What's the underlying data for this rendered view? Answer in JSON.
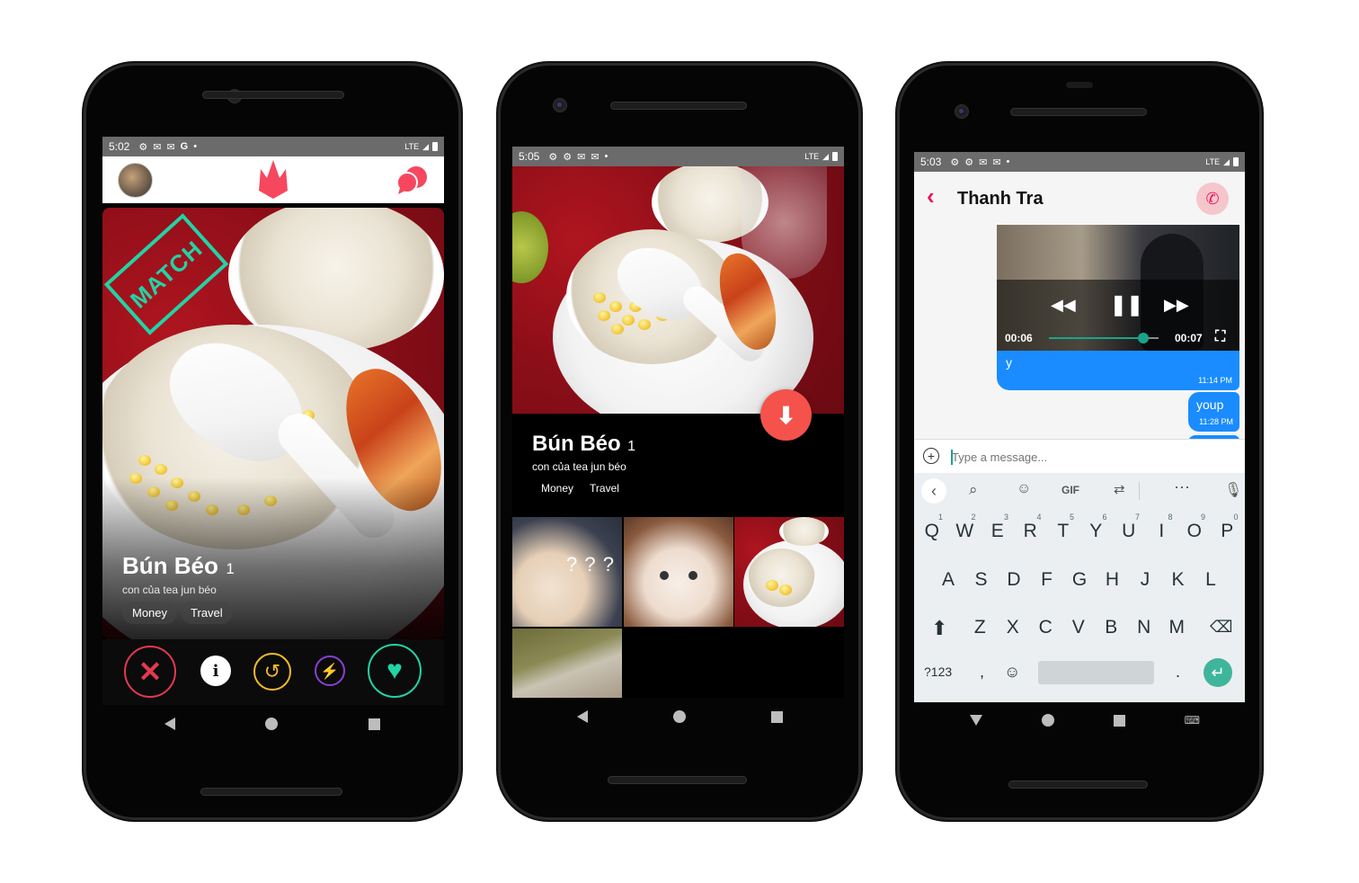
{
  "phone1": {
    "status": {
      "time": "5:02",
      "icons": [
        "gear-icon",
        "mail-icon",
        "mail-icon",
        "google-icon",
        "dot"
      ],
      "network": "LTE"
    },
    "card": {
      "stamp": "MATCH",
      "name": "Bún Béo",
      "age": "1",
      "bio": "con của tea jun béo",
      "tags": [
        "Money",
        "Travel"
      ]
    },
    "colors": {
      "brand": "#f6475f",
      "nope": "#e53950",
      "info": "#ffffff",
      "rewind": "#f2b92b",
      "boost": "#8a3fd1",
      "like": "#22d3a6",
      "stamp": "#22d3a6"
    }
  },
  "phone2": {
    "status": {
      "time": "5:05",
      "network": "LTE"
    },
    "profile": {
      "name": "Bún Béo",
      "age": "1",
      "bio": "con của tea jun béo",
      "tags": [
        "Money",
        "Travel"
      ]
    },
    "photo_overlay_text": "? ? ?",
    "colors": {
      "fab": "#f4524b"
    }
  },
  "phone3": {
    "status": {
      "time": "5:03",
      "network": "LTE"
    },
    "header": {
      "title": "Thanh Tra"
    },
    "video": {
      "current": "00:06",
      "total": "00:07",
      "progress": 0.86
    },
    "messages": [
      {
        "text": "y",
        "time": "11:14 PM"
      },
      {
        "text": "youp",
        "time": "11:28 PM"
      }
    ],
    "composer": {
      "placeholder": "Type a message..."
    },
    "keyboard": {
      "toolbar": [
        "GIF"
      ],
      "row1": [
        [
          "Q",
          "1"
        ],
        [
          "W",
          "2"
        ],
        [
          "E",
          "3"
        ],
        [
          "R",
          "4"
        ],
        [
          "T",
          "5"
        ],
        [
          "Y",
          "6"
        ],
        [
          "U",
          "7"
        ],
        [
          "I",
          "8"
        ],
        [
          "O",
          "9"
        ],
        [
          "P",
          "0"
        ]
      ],
      "row2": [
        "A",
        "S",
        "D",
        "F",
        "G",
        "H",
        "J",
        "K",
        "L"
      ],
      "row3": [
        "Z",
        "X",
        "C",
        "V",
        "B",
        "N",
        "M"
      ],
      "symbols": "?123",
      "comma": ",",
      "period": "."
    },
    "colors": {
      "accent": "#e8175d",
      "bubble": "#1a8cff",
      "call_bg": "#f5c6cc",
      "kb_bg": "#eceff1",
      "enter": "#3fb59c"
    }
  }
}
